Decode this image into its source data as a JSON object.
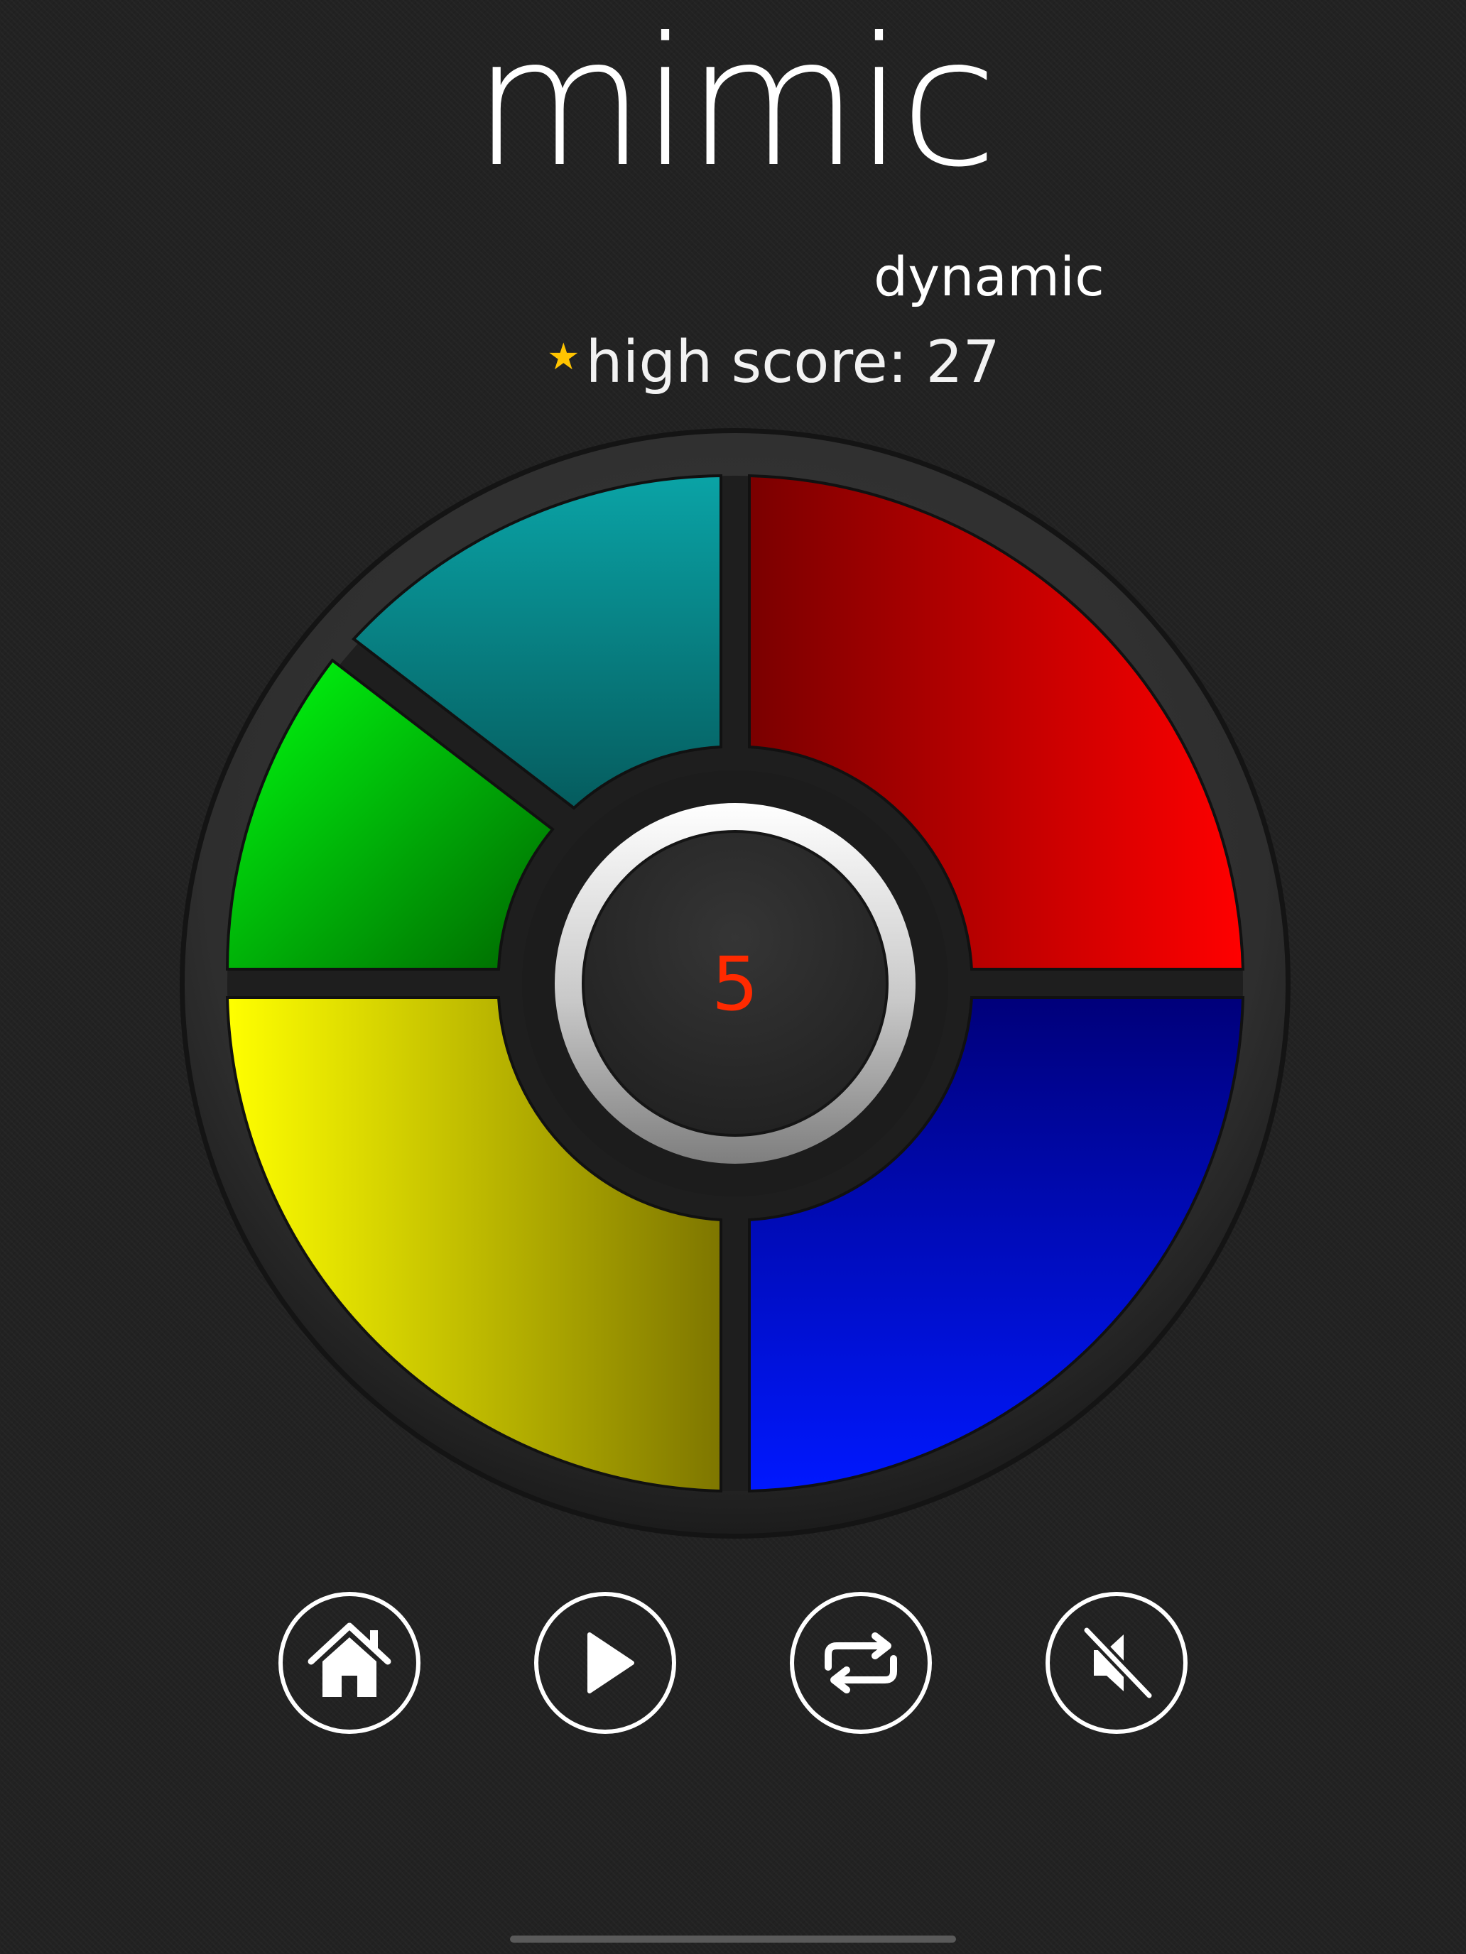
{
  "game": {
    "title": "mimic",
    "mode": "dynamic",
    "high_score_label": "high score: 27",
    "current_score": "5"
  },
  "colors": {
    "background": "#222222",
    "cyan": "#0e9fa3",
    "red": "#e00000",
    "green": "#00c800",
    "yellow": "#e8e800",
    "blue": "#0010e0",
    "score": "#ff2a00",
    "star": "#ffc400"
  },
  "pads": [
    {
      "name": "cyan-pad",
      "color": "cyan"
    },
    {
      "name": "red-pad",
      "color": "red"
    },
    {
      "name": "green-pad",
      "color": "green"
    },
    {
      "name": "yellow-pad",
      "color": "yellow"
    },
    {
      "name": "blue-pad",
      "color": "blue"
    }
  ],
  "controls": [
    {
      "name": "home-button",
      "icon": "home-icon"
    },
    {
      "name": "play-button",
      "icon": "play-icon"
    },
    {
      "name": "repeat-button",
      "icon": "repeat-icon"
    },
    {
      "name": "mute-button",
      "icon": "speaker-muted-icon"
    }
  ]
}
